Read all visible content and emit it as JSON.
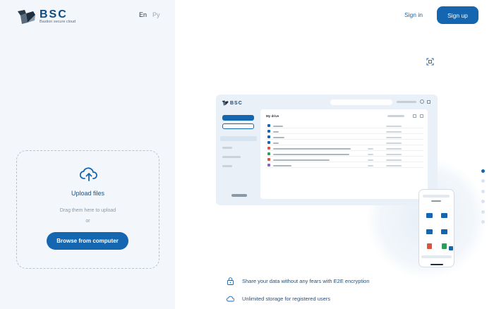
{
  "brand": {
    "name": "BSC",
    "tagline": "Bastion secure cloud"
  },
  "languages": [
    {
      "label": "En",
      "selected": true
    },
    {
      "label": "Ру",
      "selected": false
    }
  ],
  "header": {
    "sign_in": "Sign in",
    "sign_up": "Sign up"
  },
  "upload": {
    "title": "Upload files",
    "hint": "Drag them here to upload",
    "or": "or",
    "browse_label": "Browse from computer"
  },
  "preview": {
    "title": "My drive",
    "logo": "BSC"
  },
  "slider": {
    "count": 6,
    "active_index": 0
  },
  "features": [
    {
      "icon": "lock-icon",
      "text": "Share your data without any fears with E2E encryption"
    },
    {
      "icon": "cloud-icon",
      "text": "Unlimited storage for registered users"
    }
  ],
  "colors": {
    "accent": "#1466b0",
    "panel": "#f3f7fb",
    "text_dark": "#1f2d3d"
  }
}
